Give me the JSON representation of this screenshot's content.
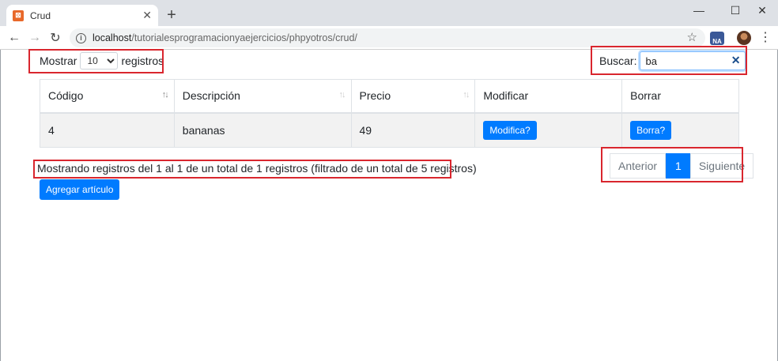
{
  "browser": {
    "tab_title": "Crud",
    "tab_favicon": "xampp-icon",
    "url_host": "localhost",
    "url_path": "/tutorialesprogramacionyaejercicios/phpyotros/crud/"
  },
  "length_control": {
    "prefix": "Mostrar",
    "selected": "10",
    "suffix": "registros"
  },
  "search": {
    "label": "Buscar:",
    "value": "ba"
  },
  "table": {
    "headers": [
      "Código",
      "Descripción",
      "Precio",
      "Modificar",
      "Borrar"
    ],
    "rows": [
      {
        "codigo": "4",
        "descripcion": "bananas",
        "precio": "49",
        "modificar": "Modifica?",
        "borrar": "Borra?"
      }
    ]
  },
  "info_text": "Mostrando registros del 1 al 1 de un total de 1 registros (filtrado de un total de 5 registros)",
  "add_button": "Agregar artículo",
  "pagination": {
    "previous": "Anterior",
    "current": "1",
    "next": "Siguiente"
  },
  "colors": {
    "primary": "#007bff",
    "highlight_box": "#d9262e"
  }
}
